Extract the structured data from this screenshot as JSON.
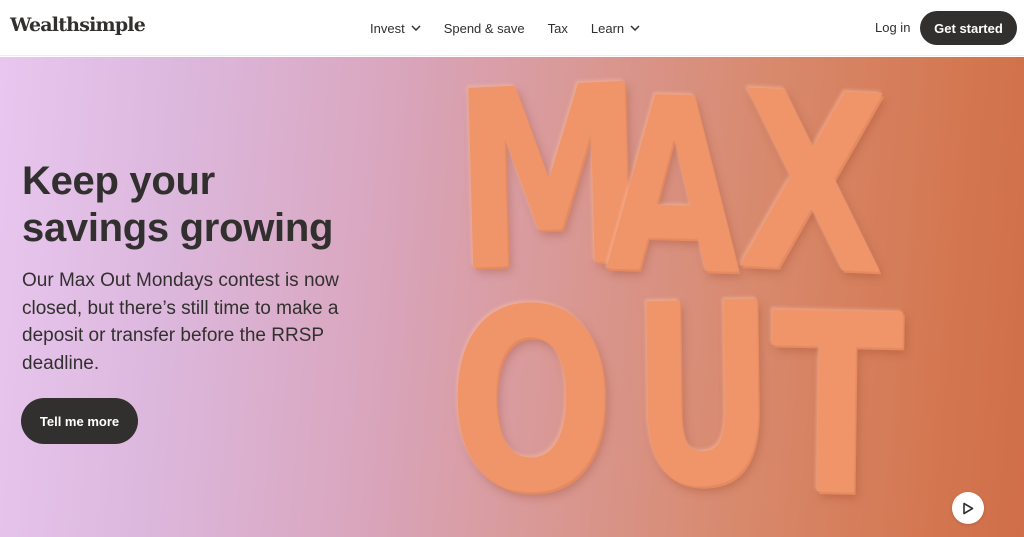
{
  "header": {
    "logo": "Wealthsimple",
    "nav": [
      {
        "label": "Invest",
        "has_chevron": true
      },
      {
        "label": "Spend & save",
        "has_chevron": false
      },
      {
        "label": "Tax",
        "has_chevron": false
      },
      {
        "label": "Learn",
        "has_chevron": true
      }
    ],
    "login_label": "Log in",
    "cta_label": "Get started"
  },
  "hero": {
    "headline": "Keep your savings growing",
    "description": "Our Max Out Mondays contest is now closed, but there’s still time to make a deposit or transfer before the RRSP deadline.",
    "button_label": "Tell me more",
    "art_letters": [
      "M",
      "A",
      "X",
      "O",
      "U",
      "T"
    ],
    "play_icon": "play-icon"
  },
  "colors": {
    "dark": "#32302f",
    "gradient_start": "#e8c6ef",
    "gradient_end": "#cf6e48",
    "letter_orange": "#f0946a"
  }
}
